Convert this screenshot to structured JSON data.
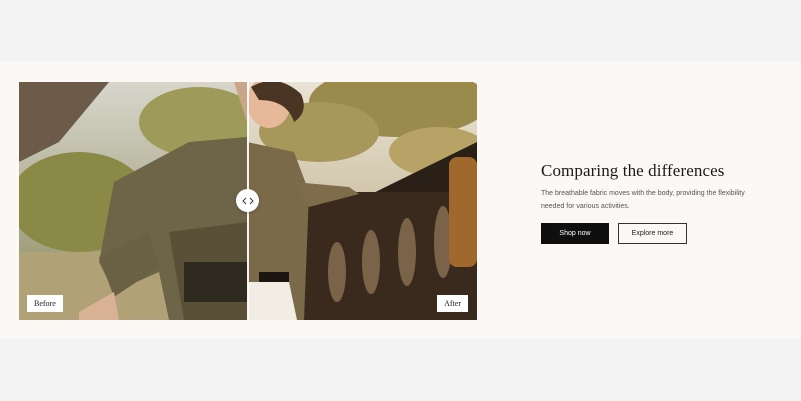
{
  "comparison": {
    "before_label": "Before",
    "after_label": "After",
    "handle_icon": "chevrons-left-right-icon",
    "slider_position_percent": 50
  },
  "content": {
    "heading": "Comparing the differences",
    "description": "The breathable fabric moves with the body, providing the flexibility needed for various activities.",
    "primary_button": "Shop now",
    "secondary_button": "Explore more"
  },
  "colors": {
    "page_background": "#f3f3f3",
    "section_background": "#fcf8f5",
    "primary_button": "#0f0f0f"
  }
}
